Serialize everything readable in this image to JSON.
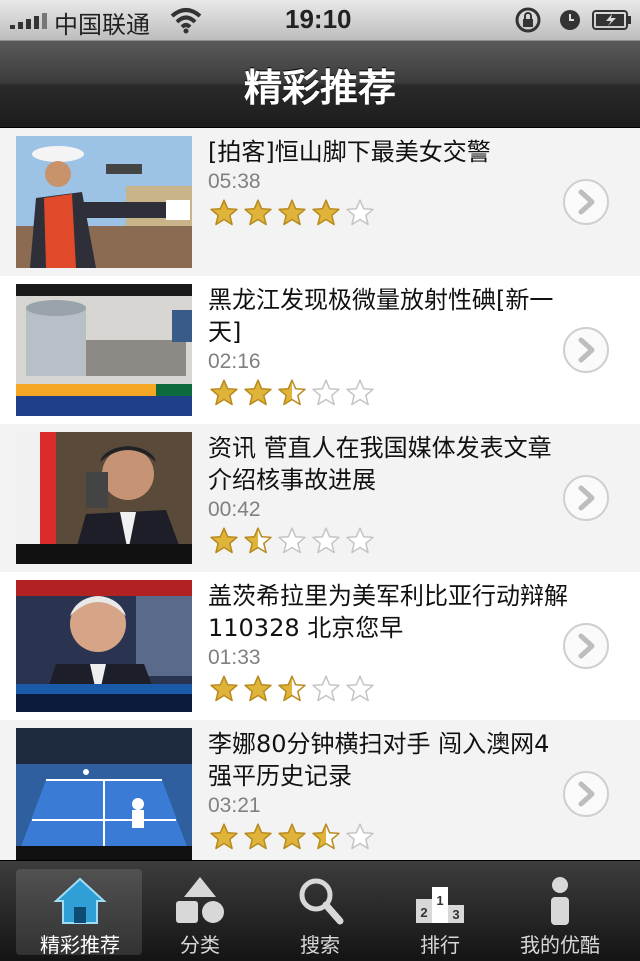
{
  "status_bar": {
    "carrier": "中国联通",
    "time": "19:10"
  },
  "nav": {
    "title": "精彩推荐"
  },
  "videos": [
    {
      "title": "[拍客]恒山脚下最美女交警",
      "duration": "05:38",
      "rating": 4
    },
    {
      "title": "黑龙江发现极微量放射性碘[新一天]",
      "duration": "02:16",
      "rating": 2.5
    },
    {
      "title": "资讯 菅直人在我国媒体发表文章介绍核事故进展",
      "duration": "00:42",
      "rating": 1.5
    },
    {
      "title": "盖茨希拉里为美军利比亚行动辩解 110328 北京您早",
      "duration": "01:33",
      "rating": 2.5
    },
    {
      "title": "李娜80分钟横扫对手 闯入澳网4强平历史记录",
      "duration": "03:21",
      "rating": 3.5
    }
  ],
  "tabs": [
    {
      "label": "精彩推荐",
      "icon": "home-icon",
      "active": true
    },
    {
      "label": "分类",
      "icon": "shapes-icon",
      "active": false
    },
    {
      "label": "搜索",
      "icon": "search-icon",
      "active": false
    },
    {
      "label": "排行",
      "icon": "podium-icon",
      "active": false
    },
    {
      "label": "我的优酷",
      "icon": "person-icon",
      "active": false
    }
  ],
  "colors": {
    "accent": "#2f9fd6",
    "star_fill": "#e0b43a",
    "duration_text": "#808080"
  }
}
